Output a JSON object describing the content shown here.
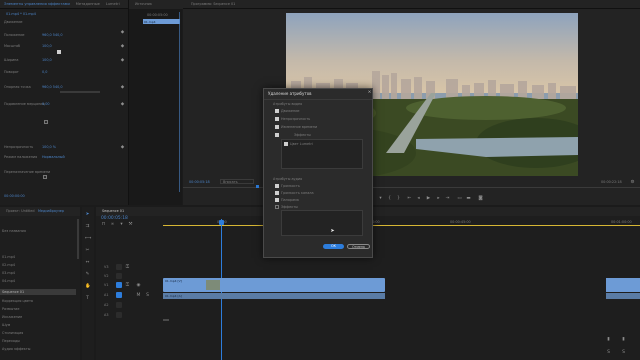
{
  "left_panel": {
    "tabs": [
      "Элементы управления эффектами",
      "Метаданные",
      "Lumetri",
      "Звуковые дорожки"
    ],
    "active_tab_index": 0,
    "clip_label": "01.mp4 * 01.mp4",
    "rows": [
      {
        "label": "Движение",
        "value": ""
      },
      {
        "label": "Положение",
        "value": "960,0  540,0"
      },
      {
        "label": "Масштаб",
        "value": "100,0"
      },
      {
        "label": "Ширина",
        "value": "100,0"
      },
      {
        "label": "Поворот",
        "value": "0,0"
      },
      {
        "label": "Опорная точка",
        "value": "960,0  540,0"
      },
      {
        "label": "Подавление мерцания",
        "value": "0,00"
      },
      {
        "label": "Непрозрачность",
        "value": "100,0 %"
      },
      {
        "label": "Режим наложения",
        "value": "Нормальный"
      },
      {
        "label": "Переназначение времени",
        "value": ""
      }
    ],
    "timecode": "00:00:00:00"
  },
  "mini_timeline": {
    "tabs": [
      "Источник",
      "Монтаж"
    ],
    "timecode": "00:00:05:00",
    "clip_name": "01.mp4"
  },
  "program_monitor": {
    "tab": "Программа: Sequence 01",
    "timecode_left": "00:00:05:18",
    "fit_label": "Вписать",
    "quality_label": "Полное",
    "timecode_right": "00:00:22:18",
    "transport_icons": [
      "marker-icon",
      "in-point-icon",
      "out-point-icon",
      "go-to-in-icon",
      "step-back-icon",
      "play-icon",
      "step-forward-icon",
      "go-to-out-icon",
      "insert-icon",
      "overwrite-icon",
      "export-frame-icon"
    ]
  },
  "dialog": {
    "title": "Удаление атрибутов",
    "video_section_label": "Атрибуты видео",
    "video_items": [
      {
        "label": "Движение",
        "checked": true
      },
      {
        "label": "Непрозрачность",
        "checked": true
      },
      {
        "label": "Изменение времени",
        "checked": true
      },
      {
        "label": "Эффекты",
        "checked": true
      }
    ],
    "effects_list": [
      "Цвет Lumetri"
    ],
    "audio_section_label": "Атрибуты аудио",
    "audio_items": [
      {
        "label": "Громкость",
        "checked": true
      },
      {
        "label": "Громкость канала",
        "checked": true
      },
      {
        "label": "Панорама",
        "checked": true
      },
      {
        "label": "Эффекты",
        "checked": false
      }
    ],
    "ok_label": "ОК",
    "cancel_label": "Отмена"
  },
  "project_panel": {
    "tabs": [
      "Проект: Untitled",
      "Медиабраузер",
      "Библиотеки"
    ],
    "items": [
      "Без названия",
      "01.mp4",
      "02.mp4",
      "03.mp4",
      "04.mp4",
      "Sequence 01",
      "Коррекция цвета",
      "Размытие",
      "Искажение",
      "Шум",
      "Стилизация",
      "Переходы",
      "Аудио эффекты"
    ]
  },
  "timeline": {
    "tab": "Sequence 01",
    "timecode": "00:00:05:18",
    "ruler_labels": [
      "00:00",
      "00:00:15:00",
      "00:00:30:00",
      "00:00:45:00",
      "00:01:00:00"
    ],
    "tracks": [
      "V3",
      "V2",
      "V1",
      "A1",
      "A2",
      "A3"
    ],
    "clip_v1_label": "01.mp4 [V]",
    "clip_a1_label": "01.mp4 [A]",
    "accent_color": "#2d7ddc",
    "clip_color": "#6d9bd6"
  },
  "tools": [
    "selection-icon",
    "track-select-icon",
    "ripple-edit-icon",
    "razor-icon",
    "slip-icon",
    "pen-icon",
    "hand-icon",
    "type-icon"
  ]
}
